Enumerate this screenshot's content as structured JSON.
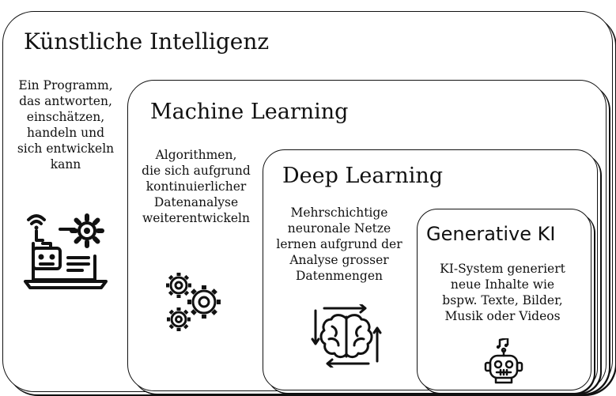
{
  "levels": {
    "ki": {
      "title": "Künstliche Intelligenz",
      "description_lines": [
        "Ein Programm,",
        "das antworten,",
        "einschätzen,",
        "handeln und",
        "sich entwickeln",
        "kann"
      ]
    },
    "ml": {
      "title": "Machine Learning",
      "description_lines": [
        "Algorithmen,",
        "die sich aufgrund",
        "kontinuierlicher",
        "Datenanalyse",
        "weiterentwickeln"
      ]
    },
    "dl": {
      "title": "Deep Learning",
      "description_lines": [
        "Mehrschichtige",
        "neuronale Netze",
        "lernen aufgrund der",
        "Analyse grosser",
        "Datenmengen"
      ]
    },
    "gen": {
      "title": "Generative KI",
      "description_lines": [
        "KI-System generiert",
        "neue Inhalte wie",
        "bspw. Texte, Bilder,",
        "Musik oder Videos"
      ]
    }
  },
  "icons": {
    "ki": "laptop-robot-gear-icon",
    "ml": "gears-icon",
    "dl": "brain-arrows-icon",
    "gen": "robot-music-icon"
  },
  "colors": {
    "line": "#111111",
    "background": "#ffffff"
  }
}
